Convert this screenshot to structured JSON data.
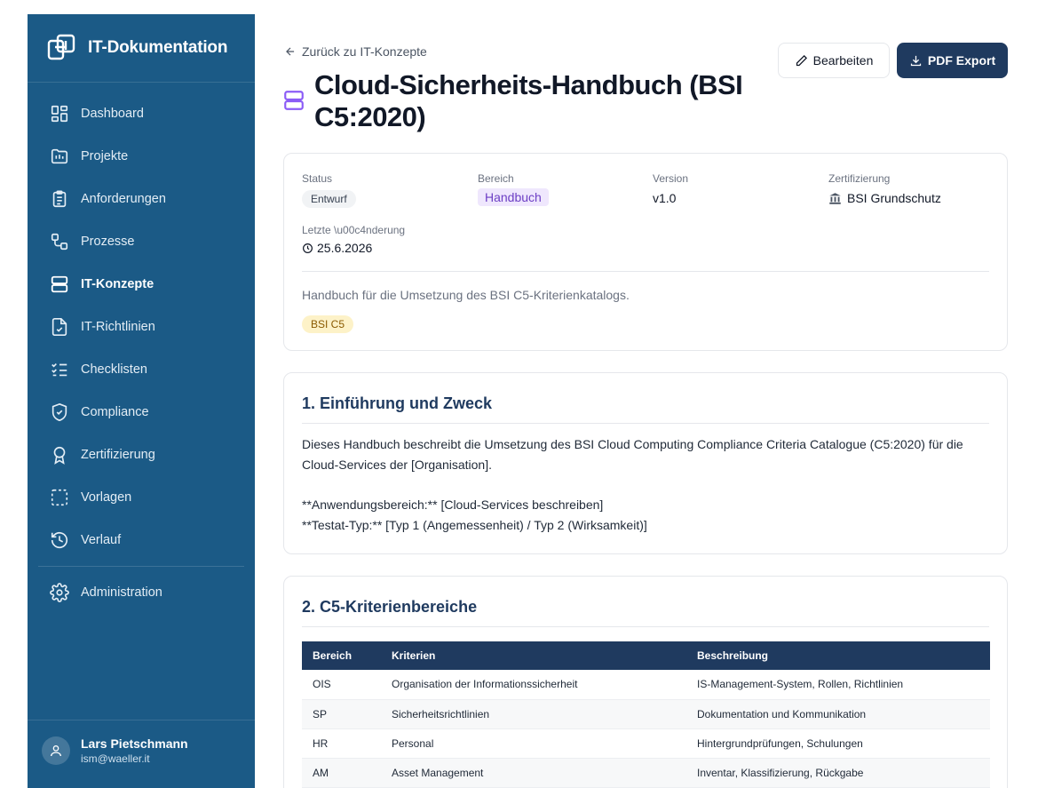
{
  "app": {
    "title": "IT-Dokumentation"
  },
  "sidebar": {
    "items": [
      {
        "label": "Dashboard",
        "icon": "dashboard-icon"
      },
      {
        "label": "Projekte",
        "icon": "folder-chart-icon"
      },
      {
        "label": "Anforderungen",
        "icon": "clipboard-list-icon"
      },
      {
        "label": "Prozesse",
        "icon": "workflow-icon"
      },
      {
        "label": "IT-Konzepte",
        "icon": "server-icon",
        "active": true
      },
      {
        "label": "IT-Richtlinien",
        "icon": "file-check-icon"
      },
      {
        "label": "Checklisten",
        "icon": "list-checks-icon"
      },
      {
        "label": "Compliance",
        "icon": "shield-check-icon"
      },
      {
        "label": "Zertifizierung",
        "icon": "award-icon"
      },
      {
        "label": "Vorlagen",
        "icon": "dashed-square-icon"
      },
      {
        "label": "Verlauf",
        "icon": "history-icon"
      }
    ],
    "admin": {
      "label": "Administration",
      "icon": "gear-icon"
    },
    "user": {
      "name": "Lars Pietschmann",
      "email": "ism@waeller.it"
    }
  },
  "header": {
    "back_label": "Zurück zu IT-Konzepte",
    "title": "Cloud-Sicherheits-Handbuch (BSI C5:2020)",
    "edit_label": "Bearbeiten",
    "pdf_label": "PDF Export"
  },
  "meta": {
    "status_label": "Status",
    "status_value": "Entwurf",
    "area_label": "Bereich",
    "area_value": "Handbuch",
    "version_label": "Version",
    "version_value": "v1.0",
    "cert_label": "Zertifizierung",
    "cert_value": "BSI Grundschutz",
    "changed_label": "Letzte \\u00c4nderung",
    "changed_value": "25.6.2026",
    "description": "Handbuch für die Umsetzung des BSI C5-Kriterienkatalogs.",
    "tag": "BSI C5"
  },
  "section1": {
    "title": "1. Einführung und Zweck",
    "p1": "Dieses Handbuch beschreibt die Umsetzung des BSI Cloud Computing Compliance Criteria Catalogue (C5:2020) für die Cloud-Services der [Organisation].",
    "p2": "**Anwendungsbereich:** [Cloud-Services beschreiben]",
    "p3": "**Testat-Typ:** [Typ 1 (Angemessenheit) / Typ 2 (Wirksamkeit)]"
  },
  "section2": {
    "title": "2. C5-Kriterienbereiche",
    "columns": [
      "Bereich",
      "Kriterien",
      "Beschreibung"
    ],
    "rows": [
      [
        "OIS",
        "Organisation der Informationssicherheit",
        "IS-Management-System, Rollen, Richtlinien"
      ],
      [
        "SP",
        "Sicherheitsrichtlinien",
        "Dokumentation und Kommunikation"
      ],
      [
        "HR",
        "Personal",
        "Hintergrundprüfungen, Schulungen"
      ],
      [
        "AM",
        "Asset Management",
        "Inventar, Klassifizierung, Rückgabe"
      ]
    ]
  }
}
